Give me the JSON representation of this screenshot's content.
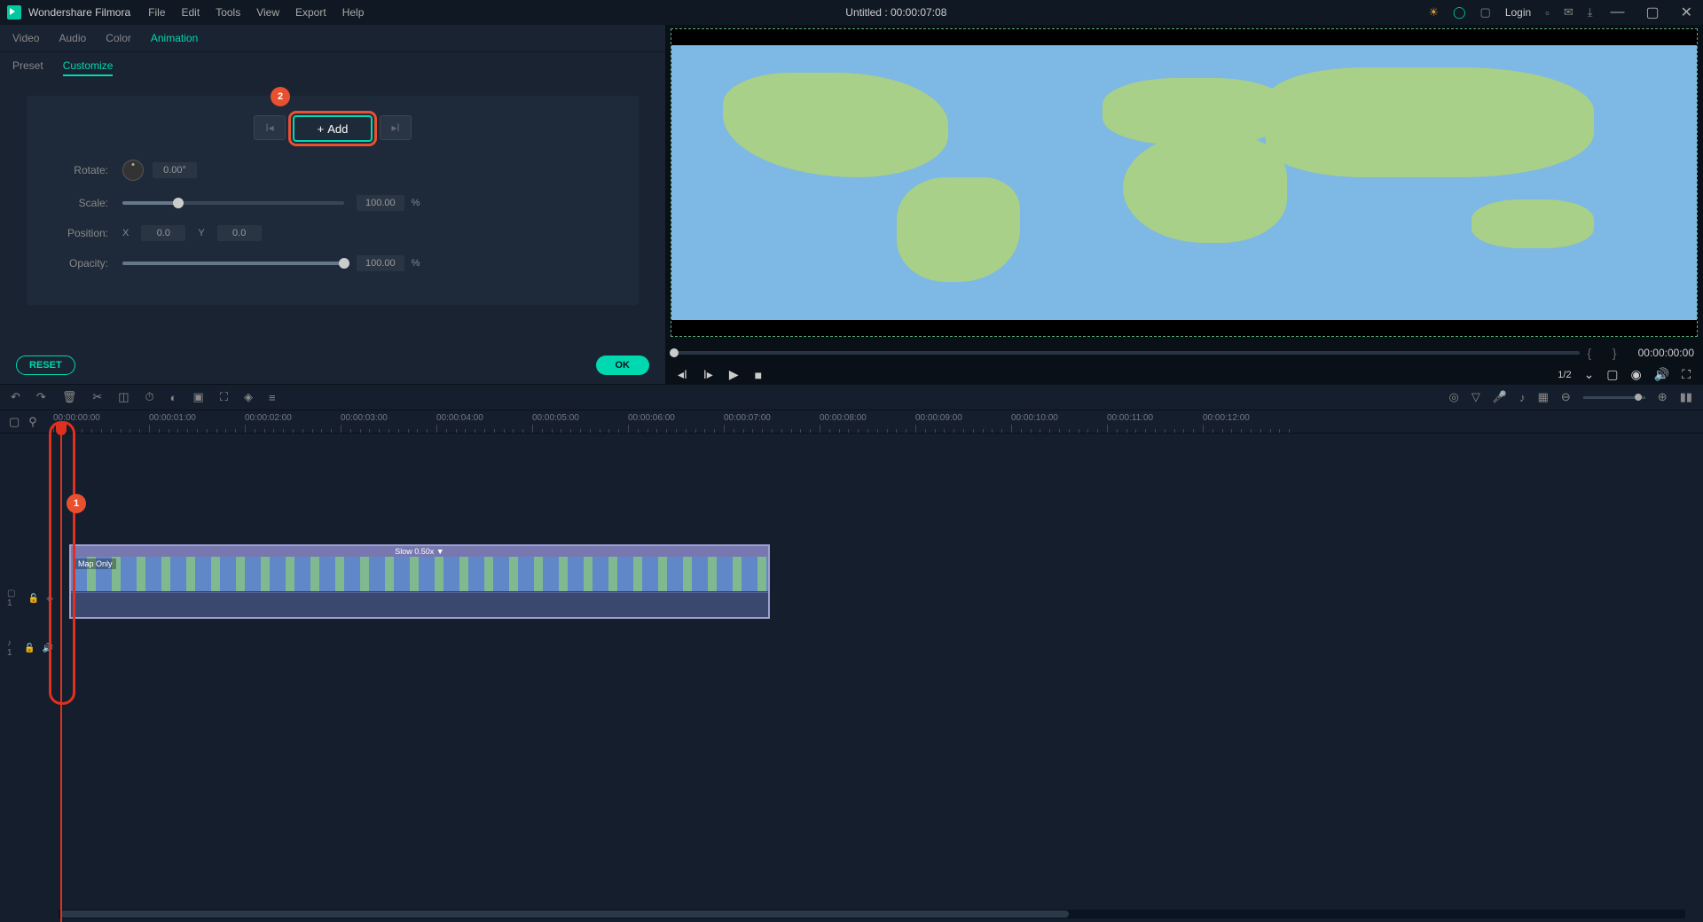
{
  "app": {
    "name": "Wondershare Filmora"
  },
  "menu": {
    "file": "File",
    "edit": "Edit",
    "tools": "Tools",
    "view": "View",
    "export": "Export",
    "help": "Help"
  },
  "title": "Untitled : 00:00:07:08",
  "login": "Login",
  "tabs1": {
    "video": "Video",
    "audio": "Audio",
    "color": "Color",
    "animation": "Animation"
  },
  "tabs2": {
    "preset": "Preset",
    "customize": "Customize"
  },
  "annotations": {
    "one": "1",
    "two": "2"
  },
  "keyframe": {
    "add": "Add"
  },
  "props": {
    "rotate": {
      "label": "Rotate:",
      "value": "0.00°"
    },
    "scale": {
      "label": "Scale:",
      "value": "100.00",
      "unit": "%",
      "percent": 25
    },
    "position": {
      "label": "Position:",
      "x_label": "X",
      "x": "0.0",
      "y_label": "Y",
      "y": "0.0"
    },
    "opacity": {
      "label": "Opacity:",
      "value": "100.00",
      "unit": "%",
      "percent": 100
    }
  },
  "actions": {
    "reset": "RESET",
    "ok": "OK"
  },
  "preview": {
    "time": "00:00:00:00",
    "ratio": "1/2"
  },
  "timeline": {
    "marks": [
      "00:00:00:00",
      "00:00:01:00",
      "00:00:02:00",
      "00:00:03:00",
      "00:00:04:00",
      "00:00:05:00",
      "00:00:06:00",
      "00:00:07:00",
      "00:00:08:00",
      "00:00:09:00",
      "00:00:10:00",
      "00:00:11:00",
      "00:00:12:00"
    ],
    "clip": {
      "speed": "Slow 0.50x ▼",
      "name": "Map Only"
    },
    "video_track": "▢ 1",
    "audio_track": "♪ 1"
  }
}
